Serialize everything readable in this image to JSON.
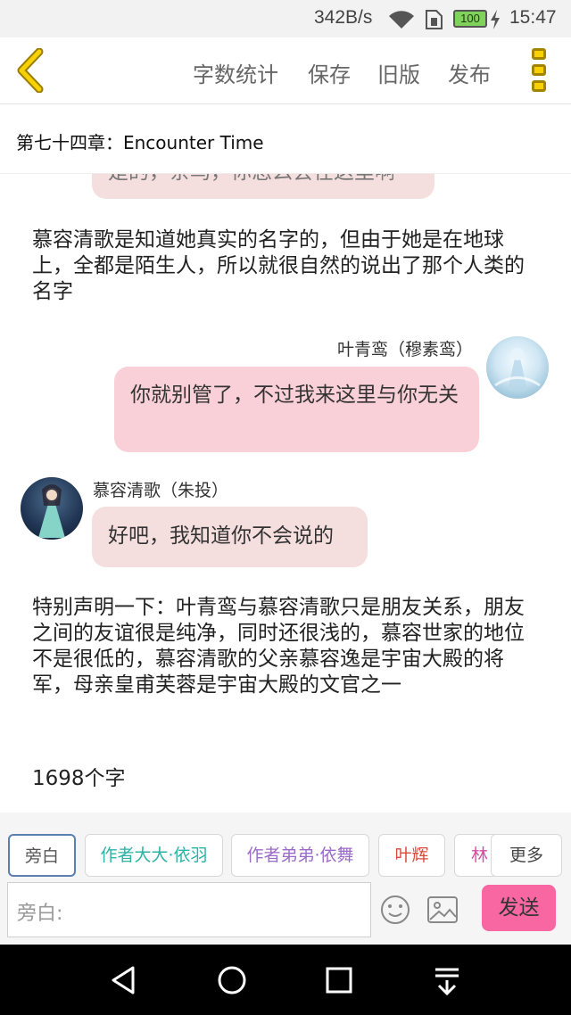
{
  "status_bar": {
    "net_speed": "342B/s",
    "battery": "100",
    "time": "15:47",
    "icons": [
      "wifi-icon",
      "sim-icon",
      "battery-icon",
      "charging-icon"
    ]
  },
  "header": {
    "back_icon": "chevron-left-icon",
    "links": [
      "字数统计",
      "保存",
      "旧版",
      "发布"
    ],
    "menu_icon": "more-vertical-icon",
    "accent_color": "#f7d100"
  },
  "chapter": {
    "title": "第七十四章：Encounter Time"
  },
  "messages": {
    "top_partial": "是的，亲鸟，你怎么会在这里啊",
    "narration_1": "慕容清歌是知道她真实的名字的，但由于她是在地球上，全都是陌生人，所以就很自然的说出了那个人类的名字",
    "right_speaker": "叶青鸾（穆素鸾）",
    "right_text": "你就别管了，不过我来这里与你无关",
    "left_speaker": "慕容清歌（朱投）",
    "left_text": "好吧，我知道你不会说的",
    "narration_2": "特别声明一下：叶青鸾与慕容清歌只是朋友关系，朋友之间的友谊很是纯净，同时还很浅的，慕容世家的地位不是很低的，慕容清歌的父亲慕容逸是宇宙大殿的将军，母亲皇甫芙蓉是宇宙大殿的文官之一",
    "word_count": "1698个字"
  },
  "characters": {
    "narrator": "旁白",
    "char_1": "作者大大·依羽",
    "char_2": "作者弟弟·依舞",
    "char_3": "叶辉",
    "char_4": "林",
    "more": "更多"
  },
  "composer": {
    "placeholder": "旁白:",
    "emoji_icon": "smiley-icon",
    "image_icon": "image-icon",
    "send": "发送",
    "send_color": "#f867a2"
  },
  "nav": {
    "icons": [
      "back-triangle-icon",
      "home-circle-icon",
      "recents-square-icon",
      "notification-pull-icon"
    ]
  }
}
